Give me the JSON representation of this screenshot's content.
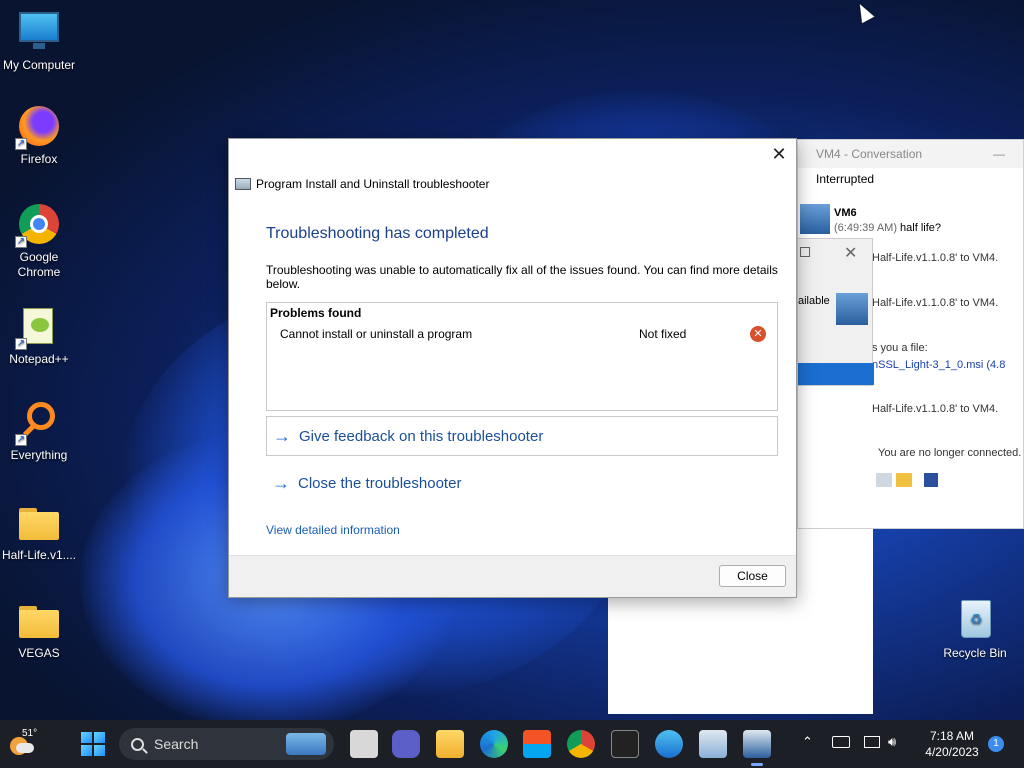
{
  "desktop": {
    "icons": [
      {
        "label": "My Computer",
        "icon": "monitor-icon"
      },
      {
        "label": "Firefox",
        "icon": "firefox-icon"
      },
      {
        "label": "Google Chrome",
        "icon": "chrome-icon"
      },
      {
        "label": "Notepad++",
        "icon": "notepadpp-icon"
      },
      {
        "label": "Everything",
        "icon": "everything-search-icon"
      },
      {
        "label": "Half-Life.v1....",
        "icon": "folder-icon"
      },
      {
        "label": "VEGAS",
        "icon": "folder-icon"
      },
      {
        "label": "Recycle Bin",
        "icon": "recycle-bin-icon"
      }
    ]
  },
  "vm4_window": {
    "title": "VM4 - Conversation",
    "status": "Interrupted",
    "sender": "VM6",
    "time": "(6:49:39 AM)",
    "message": "half life?",
    "lines": [
      "Half-Life.v1.1.0.8' to VM4.",
      "Half-Life.v1.1.0.8' to VM4.",
      "s you a file:",
      "nSSL_Light-3_1_0.msi (4.8",
      "Half-Life.v1.1.0.8' to VM4.",
      "You are no longer connected."
    ],
    "panel_text": "ailable"
  },
  "dialog": {
    "title": "Program Install and Uninstall troubleshooter",
    "heading": "Troubleshooting has completed",
    "description": "Troubleshooting was unable to automatically fix all of the issues found. You can find more details below.",
    "problems_title": "Problems found",
    "problems": [
      {
        "name": "Cannot install or uninstall a program",
        "status": "Not fixed"
      }
    ],
    "feedback_link": "Give feedback on this troubleshooter",
    "close_link": "Close the troubleshooter",
    "detail_link": "View detailed information",
    "close_button": "Close"
  },
  "taskbar": {
    "weather_temp": "51°",
    "search_placeholder": "Search",
    "time": "7:18 AM",
    "date": "4/20/2023",
    "notification_count": "1"
  },
  "colors": {
    "accent": "#1f6dd1",
    "heading": "#1b3f8f",
    "error": "#d8502c",
    "taskbar": "#1c1f26"
  }
}
